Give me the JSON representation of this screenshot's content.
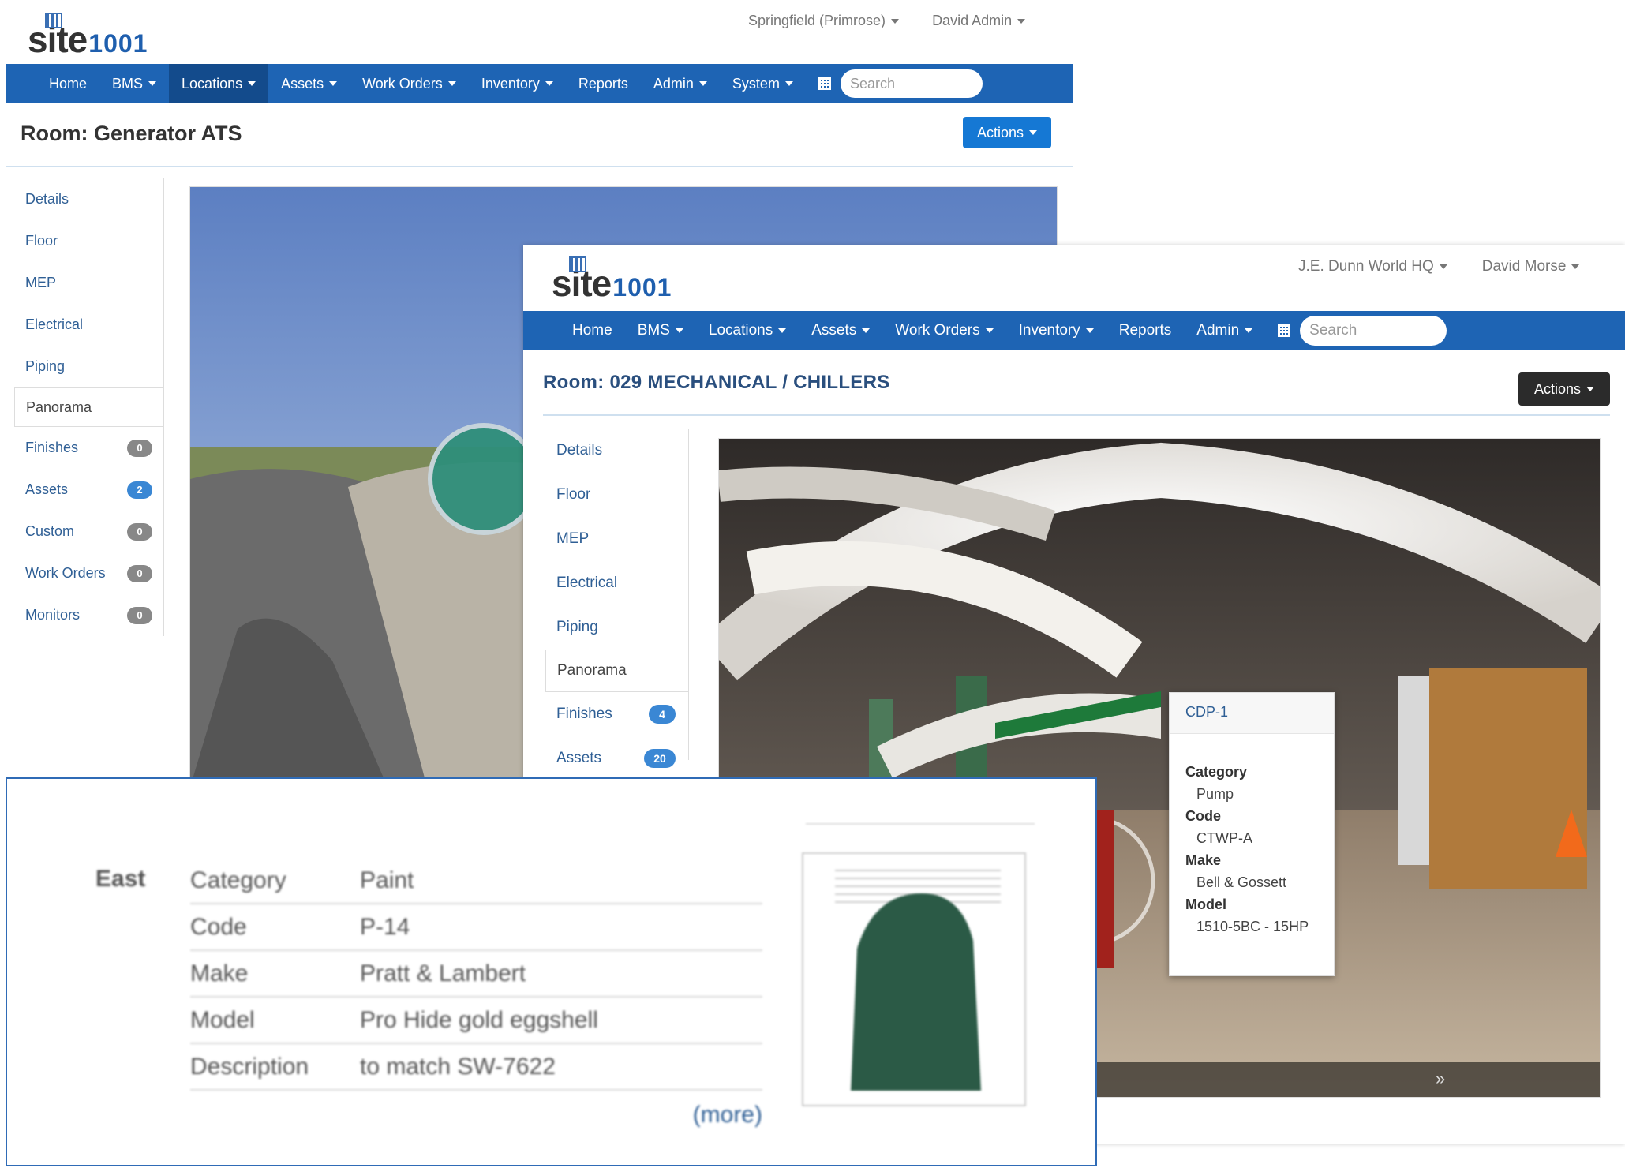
{
  "back": {
    "logo": {
      "word": "site",
      "num": "1001"
    },
    "location": "Springfield (Primrose)",
    "user": "David Admin",
    "nav": [
      "Home",
      "BMS",
      "Locations",
      "Assets",
      "Work Orders",
      "Inventory",
      "Reports",
      "Admin",
      "System"
    ],
    "search_placeholder": "Search",
    "title": "Room: Generator ATS",
    "actions": "Actions",
    "sidebar": [
      {
        "label": "Details"
      },
      {
        "label": "Floor"
      },
      {
        "label": "MEP"
      },
      {
        "label": "Electrical"
      },
      {
        "label": "Piping"
      },
      {
        "label": "Panorama",
        "active": true
      },
      {
        "label": "Finishes",
        "badge": "0"
      },
      {
        "label": "Assets",
        "badge": "2"
      },
      {
        "label": "Custom",
        "badge": "0"
      },
      {
        "label": "Work Orders",
        "badge": "0"
      },
      {
        "label": "Monitors",
        "badge": "0"
      }
    ]
  },
  "front": {
    "logo": {
      "word": "site",
      "num": "1001"
    },
    "location": "J.E. Dunn World HQ",
    "user": "David Morse",
    "nav": [
      "Home",
      "BMS",
      "Locations",
      "Assets",
      "Work Orders",
      "Inventory",
      "Reports",
      "Admin"
    ],
    "search_placeholder": "Search",
    "title": "Room: 029 MECHANICAL / CHILLERS",
    "actions": "Actions",
    "sidebar": [
      {
        "label": "Details"
      },
      {
        "label": "Floor"
      },
      {
        "label": "MEP"
      },
      {
        "label": "Electrical"
      },
      {
        "label": "Piping"
      },
      {
        "label": "Panorama",
        "active": true
      },
      {
        "label": "Finishes",
        "badge": "4"
      },
      {
        "label": "Assets",
        "badge": "20"
      }
    ],
    "tooltip": {
      "title": "CDP-1",
      "fields": [
        {
          "label": "Category",
          "value": "Pump"
        },
        {
          "label": "Code",
          "value": "CTWP-A"
        },
        {
          "label": "Make",
          "value": "Bell & Gossett"
        },
        {
          "label": "Model",
          "value": "1510-5BC - 15HP"
        }
      ]
    },
    "pano_next": "»"
  },
  "zoom": {
    "side_label": "East",
    "rows": [
      {
        "key": "Category",
        "value": "Paint"
      },
      {
        "key": "Code",
        "value": "P-14"
      },
      {
        "key": "Make",
        "value": "Pratt & Lambert"
      },
      {
        "key": "Model",
        "value": "Pro Hide gold eggshell"
      },
      {
        "key": "Description",
        "value": "to match SW-7622"
      }
    ],
    "more": "(more)",
    "swatch_color": "#2b5a46"
  },
  "colors": {
    "nav_blue": "#1e64b4",
    "nav_active": "#134b8c",
    "actions_blue": "#1578d4",
    "actions_dark": "#2b2b2b",
    "link": "#2f5f95"
  }
}
